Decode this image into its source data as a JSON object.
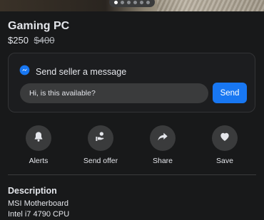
{
  "listing": {
    "title": "Gaming PC",
    "price": "$250",
    "original_price": "$400"
  },
  "carousel": {
    "count": 6,
    "active_index": 0
  },
  "message_box": {
    "header": "Send seller a message",
    "input_value": "Hi, is this available?",
    "send_label": "Send"
  },
  "actions": [
    {
      "label": "Alerts",
      "icon": "bell-icon"
    },
    {
      "label": "Send offer",
      "icon": "offer-icon"
    },
    {
      "label": "Share",
      "icon": "share-icon"
    },
    {
      "label": "Save",
      "icon": "heart-icon"
    }
  ],
  "description": {
    "title": "Description",
    "lines": [
      "MSI Motherboard",
      "Intel i7 4790 CPU"
    ]
  },
  "colors": {
    "accent": "#1877f2",
    "background": "#18191a",
    "surface": "#3a3b3c"
  }
}
